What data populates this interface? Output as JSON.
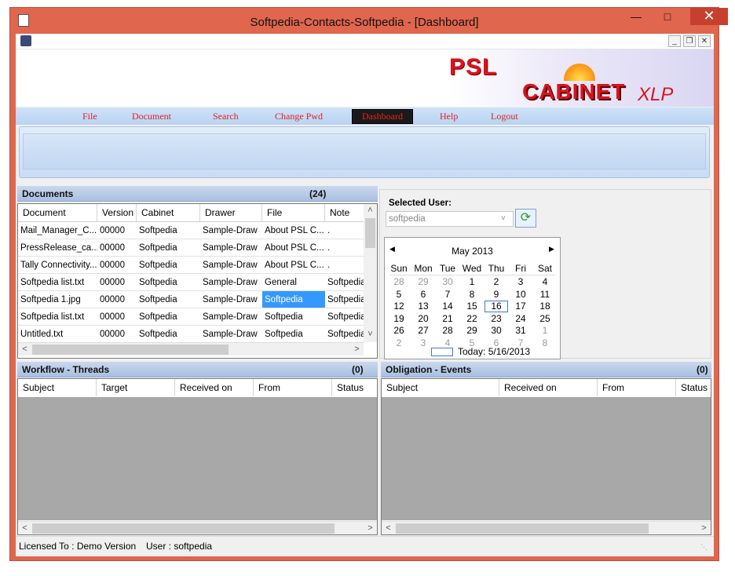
{
  "window": {
    "title": "Softpedia-Contacts-Softpedia - [Dashboard]"
  },
  "banner": {
    "psl": "PSL",
    "cabinet": "CABINET",
    "xlp": "XLP"
  },
  "menu": {
    "items": [
      "File",
      "Document",
      "Search",
      "Change Pwd",
      "Dashboard",
      "Help",
      "Logout"
    ],
    "active": "Dashboard"
  },
  "documents": {
    "title": "Documents",
    "count": "(24)",
    "columns": [
      "Document",
      "Version",
      "Cabinet",
      "Drawer",
      "File",
      "Note"
    ],
    "rows": [
      [
        "Mail_Manager_C...",
        "00000",
        "Softpedia",
        "Sample-Draw",
        "About PSL C...",
        "."
      ],
      [
        "PressRelease_ca...",
        "00000",
        "Softpedia",
        "Sample-Draw",
        "About PSL C...",
        "."
      ],
      [
        "Tally Connectivity...",
        "00000",
        "Softpedia",
        "Sample-Draw",
        "About PSL C...",
        "."
      ],
      [
        "Softpedia list.txt",
        "00000",
        "Softpedia",
        "Sample-Draw",
        "General",
        "Softpedia"
      ],
      [
        "Softpedia 1.jpg",
        "00000",
        "Softpedia",
        "Sample-Draw",
        "Softpedia",
        "Softpedia"
      ],
      [
        "Softpedia list.txt",
        "00000",
        "Softpedia",
        "Sample-Draw",
        "Softpedia",
        "Softpedia"
      ],
      [
        "Untitled.txt",
        "00000",
        "Softpedia",
        "Sample-Draw",
        "Softpedia",
        "Softpedia"
      ]
    ]
  },
  "user": {
    "label": "Selected User:",
    "value": "softpedia"
  },
  "calendar": {
    "month": "May 2013",
    "days": [
      "Sun",
      "Mon",
      "Tue",
      "Wed",
      "Thu",
      "Fri",
      "Sat"
    ],
    "weeks": [
      [
        "28",
        "29",
        "30",
        "1",
        "2",
        "3",
        "4"
      ],
      [
        "5",
        "6",
        "7",
        "8",
        "9",
        "10",
        "11"
      ],
      [
        "12",
        "13",
        "14",
        "15",
        "16",
        "17",
        "18"
      ],
      [
        "19",
        "20",
        "21",
        "22",
        "23",
        "24",
        "25"
      ],
      [
        "26",
        "27",
        "28",
        "29",
        "30",
        "31",
        "1"
      ],
      [
        "2",
        "3",
        "4",
        "5",
        "6",
        "7",
        "8"
      ]
    ],
    "selected": "16",
    "today": "Today: 5/16/2013"
  },
  "workflow": {
    "title": "Workflow - Threads",
    "count": "(0)",
    "columns": [
      "Subject",
      "Target",
      "Received on",
      "From",
      "Status"
    ]
  },
  "obligation": {
    "title": "Obligation - Events",
    "count": "(0)",
    "columns": [
      "Subject",
      "Received on",
      "From",
      "Status"
    ]
  },
  "status": {
    "licensed": "Licensed To : Demo Version",
    "user": "User : softpedia"
  },
  "colors": {
    "frame": "#e0664d",
    "menu_text": "#dd2222",
    "header": "#b9cde9",
    "selected_row": "#3399ff"
  }
}
